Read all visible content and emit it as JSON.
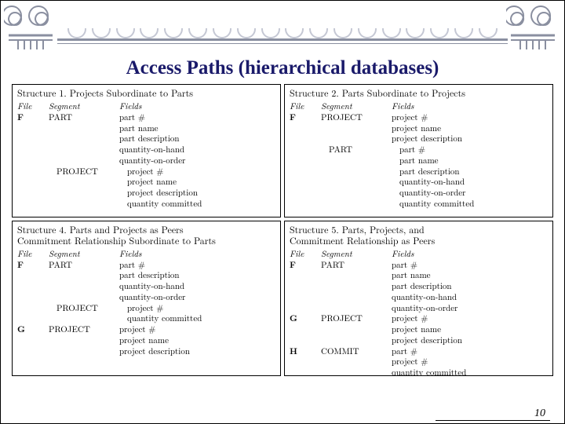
{
  "title": "Access Paths (hierarchical databases)",
  "page_number": "10",
  "structures": {
    "s1": {
      "caption_prefix": "Structure 1.",
      "caption": "Projects Subordinate to Parts",
      "headers": [
        "File",
        "Segment",
        "Fields"
      ],
      "rows": [
        {
          "file": "F",
          "segment": "PART",
          "fields": [
            "part #",
            "part name",
            "part description",
            "quantity-on-hand",
            "quantity-on-order"
          ],
          "indent": 0
        },
        {
          "file": "",
          "segment": "PROJECT",
          "fields": [
            "project #",
            "project name",
            "project description",
            "quantity committed"
          ],
          "indent": 1
        }
      ]
    },
    "s2": {
      "caption_prefix": "Structure 2.",
      "caption": "Parts Subordinate to Projects",
      "headers": [
        "File",
        "Segment",
        "Fields"
      ],
      "rows": [
        {
          "file": "F",
          "segment": "PROJECT",
          "fields": [
            "project #",
            "project name",
            "project description"
          ],
          "indent": 0
        },
        {
          "file": "",
          "segment": "PART",
          "fields": [
            "part #",
            "part name",
            "part description",
            "quantity-on-hand",
            "quantity-on-order",
            "quantity committed"
          ],
          "indent": 1
        }
      ]
    },
    "s4": {
      "caption_prefix": "Structure 4.",
      "caption": "Parts and Projects as Peers\nCommitment Relationship Subordinate to Parts",
      "headers": [
        "File",
        "Segment",
        "Fields"
      ],
      "rows": [
        {
          "file": "F",
          "segment": "PART",
          "fields": [
            "part #",
            "part description",
            "quantity-on-hand",
            "quantity-on-order"
          ],
          "indent": 0
        },
        {
          "file": "",
          "segment": "PROJECT",
          "fields": [
            "project #",
            "quantity committed"
          ],
          "indent": 1
        },
        {
          "file": "G",
          "segment": "PROJECT",
          "fields": [
            "project #",
            "project name",
            "project description"
          ],
          "indent": 0
        }
      ]
    },
    "s5": {
      "caption_prefix": "Structure 5.",
      "caption": "Parts, Projects, and\nCommitment Relationship as Peers",
      "headers": [
        "File",
        "Segment",
        "Fields"
      ],
      "rows": [
        {
          "file": "F",
          "segment": "PART",
          "fields": [
            "part #",
            "part name",
            "part description",
            "quantity-on-hand",
            "quantity-on-order"
          ],
          "indent": 0
        },
        {
          "file": "G",
          "segment": "PROJECT",
          "fields": [
            "project #",
            "project name",
            "project description"
          ],
          "indent": 0
        },
        {
          "file": "H",
          "segment": "COMMIT",
          "fields": [
            "part #",
            "project #",
            "quantity committed"
          ],
          "indent": 0
        }
      ]
    }
  }
}
